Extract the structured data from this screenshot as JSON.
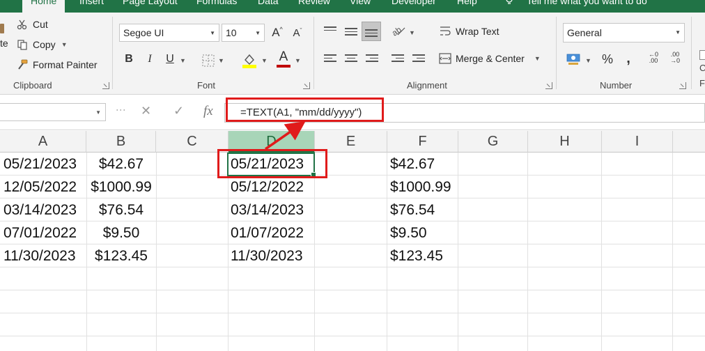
{
  "ribbon_tabs": [
    "Home",
    "Insert",
    "Page Layout",
    "Formulas",
    "Data",
    "Review",
    "View",
    "Developer",
    "Help"
  ],
  "tell_me": "Tell me what you want to do",
  "clipboard": {
    "paste_partial": "te",
    "cut": "Cut",
    "copy": "Copy",
    "format_painter": "Format Painter",
    "label": "Clipboard"
  },
  "font": {
    "family": "Segoe UI",
    "size": "10",
    "grow": "A",
    "shrink": "A",
    "bold": "B",
    "italic": "I",
    "underline": "U",
    "font_color_letter": "A",
    "label": "Font",
    "highlight_color": "#ffff00",
    "font_color": "#c00000"
  },
  "alignment": {
    "wrap_text": "Wrap Text",
    "merge_center": "Merge & Center",
    "label": "Alignment"
  },
  "number": {
    "format": "General",
    "percent": "%",
    "comma": ",",
    "inc_decimal": "←0 .00",
    "dec_decimal": ".00 →0",
    "label": "Number"
  },
  "styles_partial": [
    "C",
    "F"
  ],
  "formula_bar": {
    "fx": "fx",
    "formula": "=TEXT(A1, \"mm/dd/yyyy\")"
  },
  "columns": [
    "A",
    "B",
    "C",
    "D",
    "E",
    "F",
    "G",
    "H",
    "I"
  ],
  "selected_column": "D",
  "rows": [
    {
      "A": "05/21/2023",
      "B": "$42.67",
      "D": "05/21/2023",
      "F": "$42.67"
    },
    {
      "A": "12/05/2022",
      "B": "$1000.99",
      "D": "05/12/2022",
      "F": "$1000.99"
    },
    {
      "A": "03/14/2023",
      "B": "$76.54",
      "D": "03/14/2023",
      "F": "$76.54"
    },
    {
      "A": "07/01/2022",
      "B": "$9.50",
      "D": "01/07/2022",
      "F": "$9.50"
    },
    {
      "A": "11/30/2023",
      "B": "$123.45",
      "D": "11/30/2023",
      "F": "$123.45"
    }
  ],
  "colors": {
    "excel_green": "#217346",
    "annotation_red": "#e01b1b"
  }
}
